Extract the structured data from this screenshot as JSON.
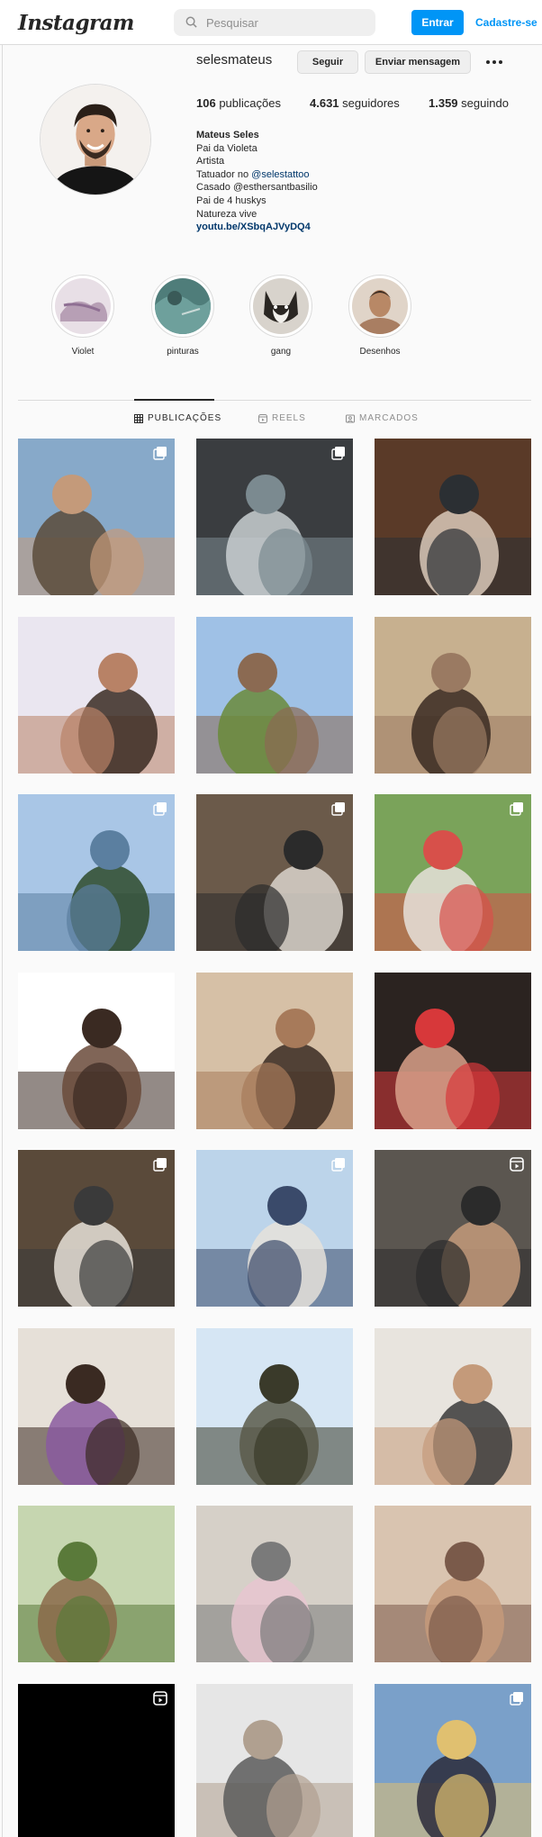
{
  "header": {
    "logo": "Instagram",
    "search_placeholder": "Pesquisar",
    "login_label": "Entrar",
    "signup_label": "Cadastre-se"
  },
  "profile": {
    "username": "selesmateus",
    "follow_label": "Seguir",
    "message_label": "Enviar mensagem",
    "posts_count": "106",
    "posts_label": "publicações",
    "followers_count": "4.631",
    "followers_label": "seguidores",
    "following_count": "1.359",
    "following_label": "seguindo",
    "bio": {
      "name": "Mateus Seles",
      "line1": "Pai da Violeta",
      "line2": "Artista",
      "line3_prefix": "Tatuador no ",
      "line3_mention": "@selestattoo",
      "line4": "Casado @esthersantbasilio",
      "line5": "Pai de 4 huskys",
      "line6": "Natureza vive",
      "link": "youtu.be/XSbqAJVyDQ4"
    }
  },
  "highlights": [
    {
      "label": "Violet",
      "color": "#c9b7c9"
    },
    {
      "label": "pinturas",
      "color": "#5f8f8c"
    },
    {
      "label": "gang",
      "color": "#cfcac2"
    },
    {
      "label": "Desenhos",
      "color": "#b58d72"
    }
  ],
  "tabs": [
    {
      "label": "PUBLICAÇÕES",
      "icon": "grid-icon",
      "active": true
    },
    {
      "label": "REELS",
      "icon": "reels-icon",
      "active": false
    },
    {
      "label": "MARCADOS",
      "icon": "tagged-icon",
      "active": false
    }
  ],
  "posts": [
    {
      "colors": [
        "#87a9c9",
        "#5a4b3a",
        "#c49a7a"
      ],
      "badge": "carousel-icon"
    },
    {
      "colors": [
        "#3a3d40",
        "#c9cfd1",
        "#7b8a90"
      ],
      "badge": "carousel-icon"
    },
    {
      "colors": [
        "#5a3a28",
        "#d9c9b8",
        "#2b2f33"
      ],
      "badge": ""
    },
    {
      "colors": [
        "#eae6f0",
        "#3a2a22",
        "#b88266"
      ],
      "badge": ""
    },
    {
      "colors": [
        "#9fc1e6",
        "#6a8a3a",
        "#8b6a52"
      ],
      "badge": ""
    },
    {
      "colors": [
        "#c7b08f",
        "#3a2a22",
        "#9a7a62"
      ],
      "badge": ""
    },
    {
      "colors": [
        "#a9c6e6",
        "#2e4a2a",
        "#5b7fa0"
      ],
      "badge": "carousel-icon"
    },
    {
      "colors": [
        "#6b5a4a",
        "#d9d3cb",
        "#2b2b2b"
      ],
      "badge": "carousel-icon"
    },
    {
      "colors": [
        "#7aa35a",
        "#e6e2da",
        "#d7504a"
      ],
      "badge": "carousel-icon"
    },
    {
      "colors": [
        "#ffffff",
        "#6a4a3a",
        "#3a2a22"
      ],
      "badge": ""
    },
    {
      "colors": [
        "#d6c0a6",
        "#3a2a22",
        "#a77a5a"
      ],
      "badge": ""
    },
    {
      "colors": [
        "#2b2320",
        "#d9a08a",
        "#d7383a"
      ],
      "badge": ""
    },
    {
      "colors": [
        "#5a4a3a",
        "#e6e0d8",
        "#3a3a3a"
      ],
      "badge": "carousel-icon"
    },
    {
      "colors": [
        "#bcd4ea",
        "#e6e2da",
        "#3a4a6a"
      ],
      "badge": "carousel-icon"
    },
    {
      "colors": [
        "#5b5650",
        "#c49a7a",
        "#2b2b2b"
      ],
      "badge": "reels-icon"
    },
    {
      "colors": [
        "#e6e0d8",
        "#8a5aa0",
        "#3a2a22"
      ],
      "badge": ""
    },
    {
      "colors": [
        "#d6e6f4",
        "#5a5a4a",
        "#3a3a2a"
      ],
      "badge": ""
    },
    {
      "colors": [
        "#e8e4de",
        "#3a3a3a",
        "#c49a7a"
      ],
      "badge": ""
    },
    {
      "colors": [
        "#c6d6b0",
        "#8a6a4a",
        "#5a7a3a"
      ],
      "badge": ""
    },
    {
      "colors": [
        "#d6d0c8",
        "#e8c6d0",
        "#7a7a7a"
      ],
      "badge": ""
    },
    {
      "colors": [
        "#d9c4b0",
        "#c49a7a",
        "#7a5a4a"
      ],
      "badge": ""
    },
    {
      "colors": [
        "#000000",
        "#000000",
        "#000000"
      ],
      "badge": "reels-icon"
    },
    {
      "colors": [
        "#e6e6e6",
        "#5a5a5a",
        "#b0a090"
      ],
      "badge": ""
    },
    {
      "colors": [
        "#7aa0c9",
        "#2a2a3a",
        "#e0c070"
      ],
      "badge": "carousel-icon"
    }
  ]
}
